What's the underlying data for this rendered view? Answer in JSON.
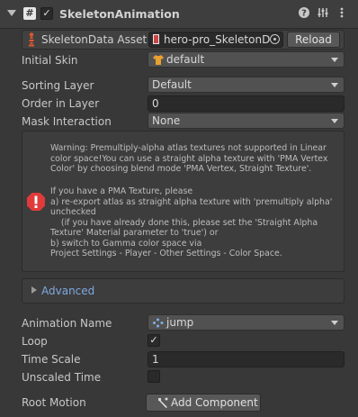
{
  "header": {
    "title": "SkeletonAnimation",
    "enabled": true,
    "component_icon": "hash-script-icon",
    "help_icon": "help-icon",
    "presets_icon": "presets-icon",
    "menu_icon": "kebab-menu-icon"
  },
  "skeleton_data": {
    "label": "SkeletonData Asset",
    "value": "hero-pro_SkeletonD",
    "reload_label": "Reload"
  },
  "fields": {
    "initial_skin": {
      "label": "Initial Skin",
      "value": "default"
    },
    "sorting_layer": {
      "label": "Sorting Layer",
      "value": "Default"
    },
    "order_in_layer": {
      "label": "Order in Layer",
      "value": "0"
    },
    "mask_interaction": {
      "label": "Mask Interaction",
      "value": "None"
    }
  },
  "warning": {
    "icon": "error-icon",
    "lines": [
      "Warning: Premultiply-alpha atlas textures not supported in Linear",
      "color space!You can use a straight alpha texture with 'PMA Vertex",
      "Color' by choosing blend mode 'PMA Vertex, Straight Texture'.",
      "",
      "If you have a PMA Texture, please",
      "a) re-export atlas as straight alpha texture with 'premultiply alpha'",
      "unchecked",
      "    (if you have already done this, please set the 'Straight Alpha",
      "Texture' Material parameter to 'true') or",
      "b) switch to Gamma color space via",
      "Project Settings - Player - Other Settings - Color Space."
    ]
  },
  "advanced": {
    "label": "Advanced"
  },
  "animation": {
    "animation_name": {
      "label": "Animation Name",
      "value": "jump"
    },
    "loop": {
      "label": "Loop",
      "checked": true
    },
    "time_scale": {
      "label": "Time Scale",
      "value": "1"
    },
    "unscaled_time": {
      "label": "Unscaled Time",
      "checked": false
    },
    "root_motion": {
      "label": "Root Motion",
      "button_label": "Add Component"
    }
  },
  "colors": {
    "accent_link": "#7fa8e0",
    "error": "#e03a3a"
  }
}
